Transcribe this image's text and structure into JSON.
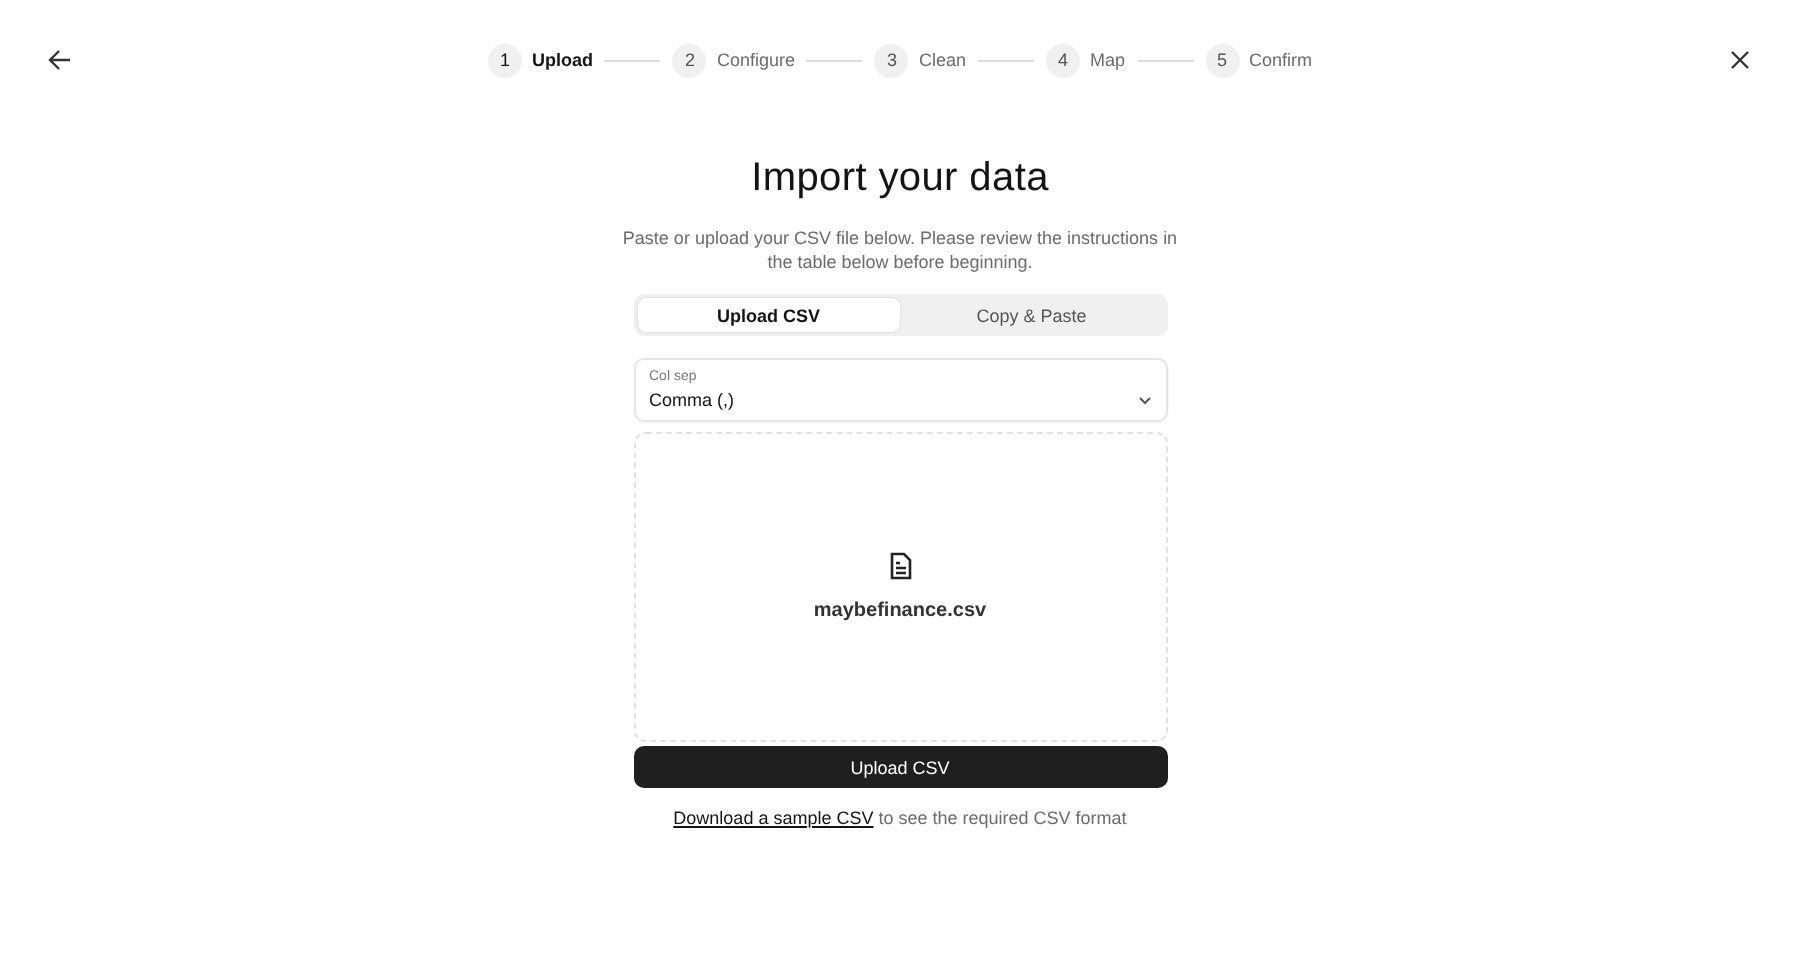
{
  "steps": [
    {
      "number": "1",
      "label": "Upload",
      "selected": true
    },
    {
      "number": "2",
      "label": "Configure",
      "selected": false
    },
    {
      "number": "3",
      "label": "Clean",
      "selected": false
    },
    {
      "number": "4",
      "label": "Map",
      "selected": false
    },
    {
      "number": "5",
      "label": "Confirm",
      "selected": false
    }
  ],
  "title": "Import your data",
  "description": "Paste or upload your CSV file below. Please review the instructions in the table below before beginning.",
  "tabs": [
    {
      "label": "Upload CSV",
      "selected": true
    },
    {
      "label": "Copy & Paste",
      "selected": false
    }
  ],
  "separator": {
    "label": "Col sep",
    "value": "Comma (,)"
  },
  "file_name": "maybefinance.csv",
  "upload_button": "Upload CSV",
  "footer": {
    "link": "Download a sample CSV",
    "text": "to see the required CSV format"
  }
}
